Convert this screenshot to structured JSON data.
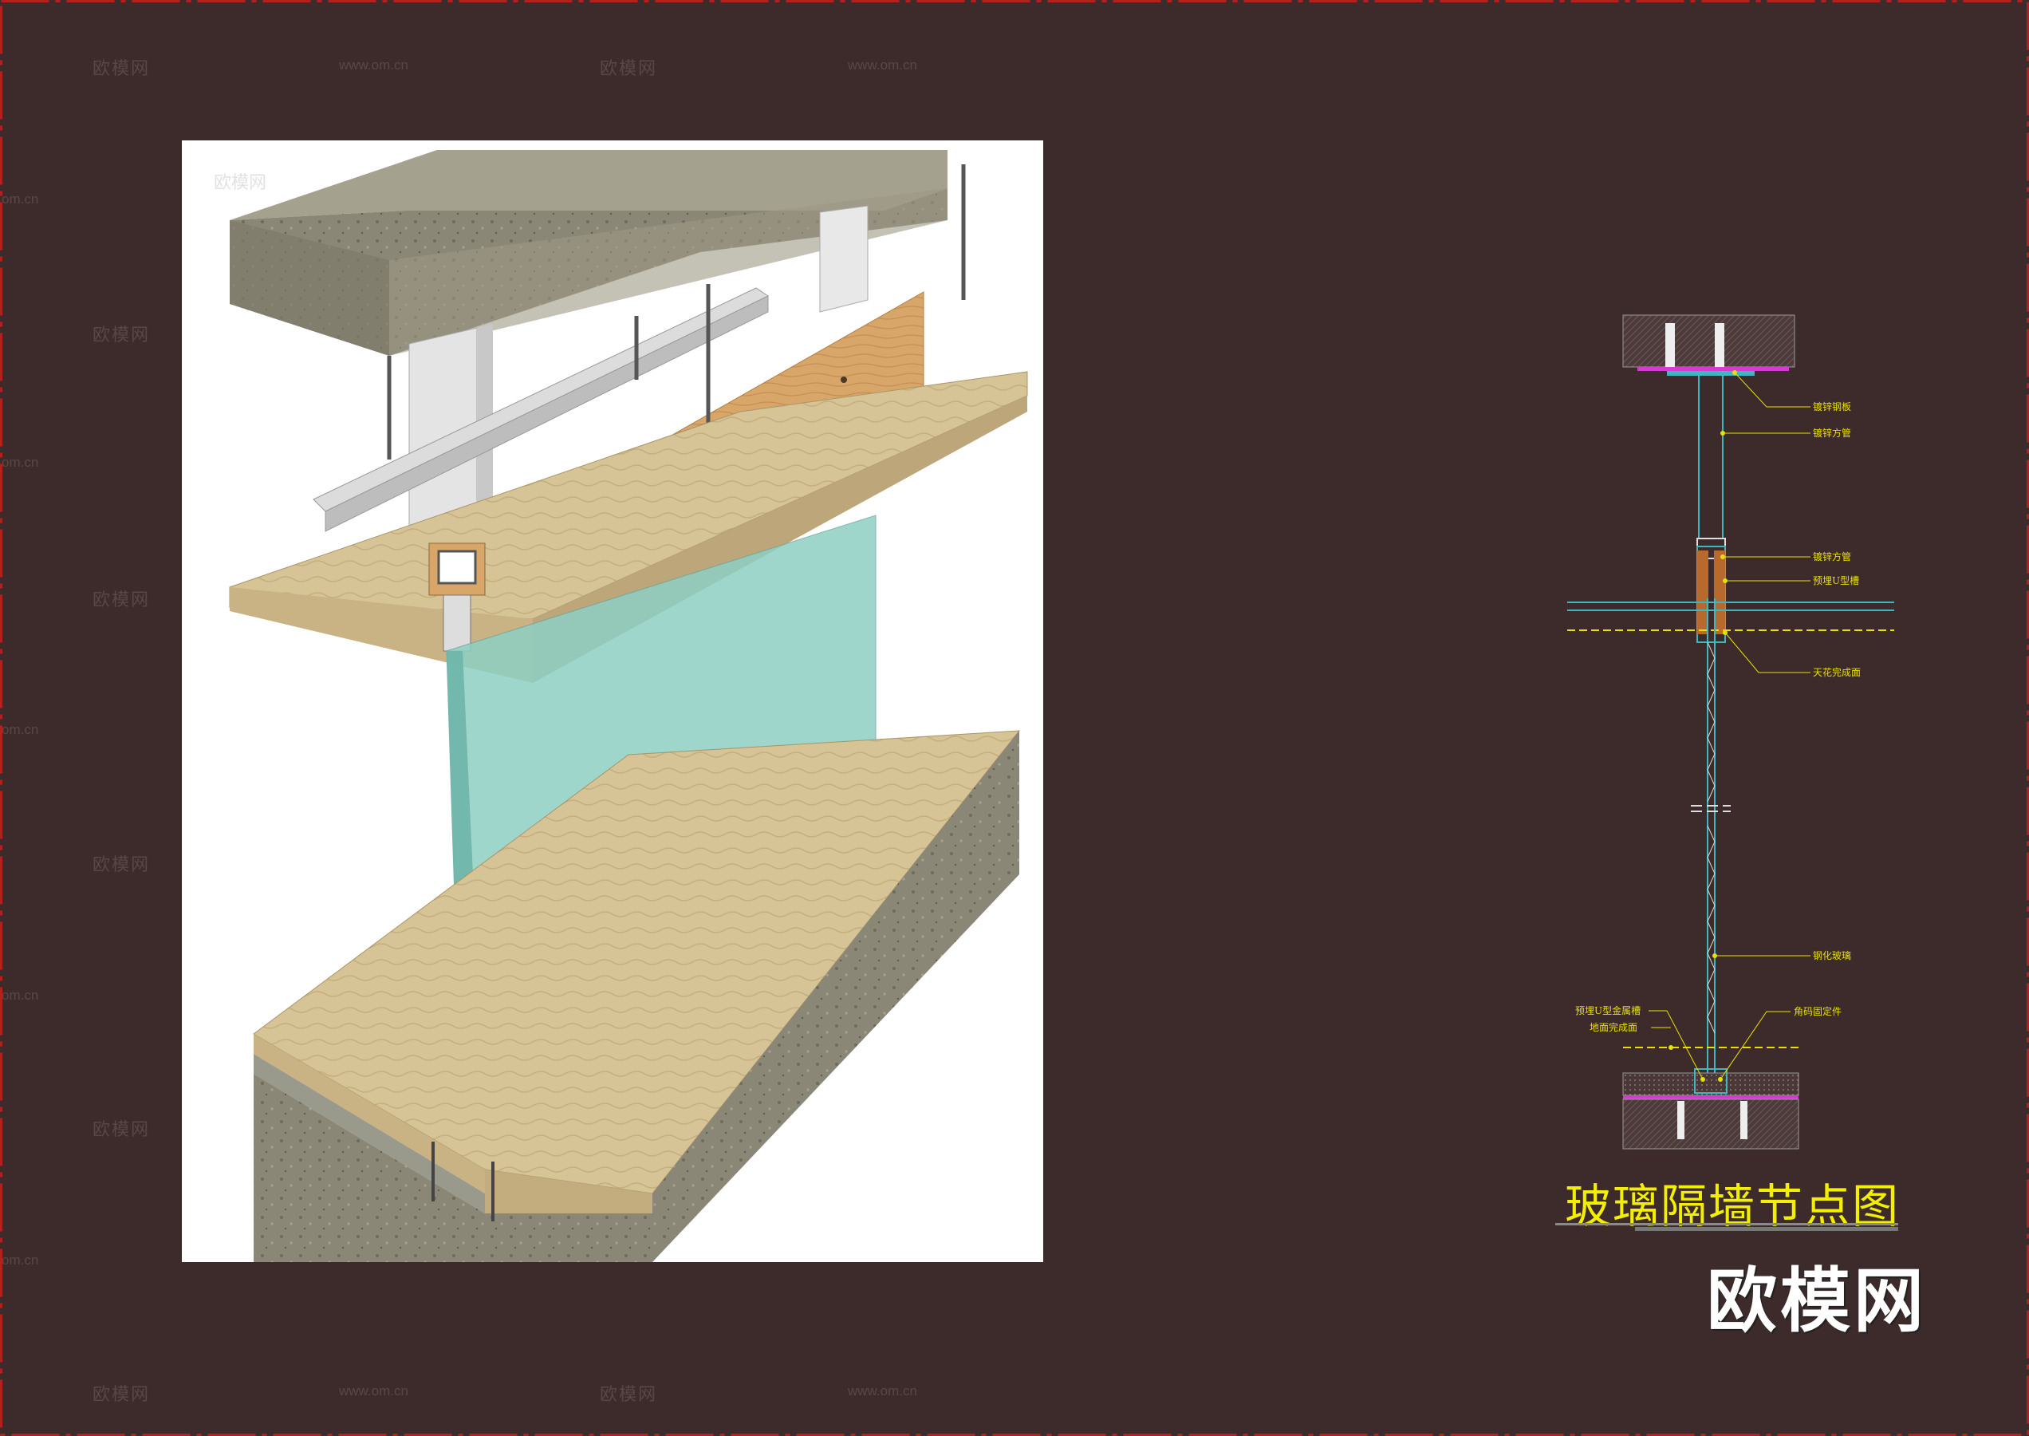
{
  "title": "玻璃隔墙节点图",
  "brand": "欧模网",
  "watermark": {
    "cn": "欧模网",
    "url": "www.om.cn",
    "url_short": "om.cn"
  },
  "labels": {
    "galv_steel_plate": "镀锌钢板",
    "galv_square_tube_1": "镀锌方管",
    "galv_square_tube_2": "镀锌方管",
    "embedded_u_channel_top": "预埋U型槽",
    "ceiling_finish": "天花完成面",
    "tempered_glass": "钢化玻璃",
    "embedded_u_metal_channel": "预埋U型金属槽",
    "floor_finish": "地面完成面",
    "angle_fixing": "角码固定件"
  },
  "colors": {
    "background": "#3d2b2b",
    "frame_red": "#b42020",
    "annotation": "#e8e000",
    "glass": "#8ecfc3",
    "tube_cyan": "#3fb6c0",
    "magenta": "#d43ccf",
    "wood": "#d9a66a",
    "concrete": "#8f8b7c",
    "plywood": "#d9c79a"
  }
}
